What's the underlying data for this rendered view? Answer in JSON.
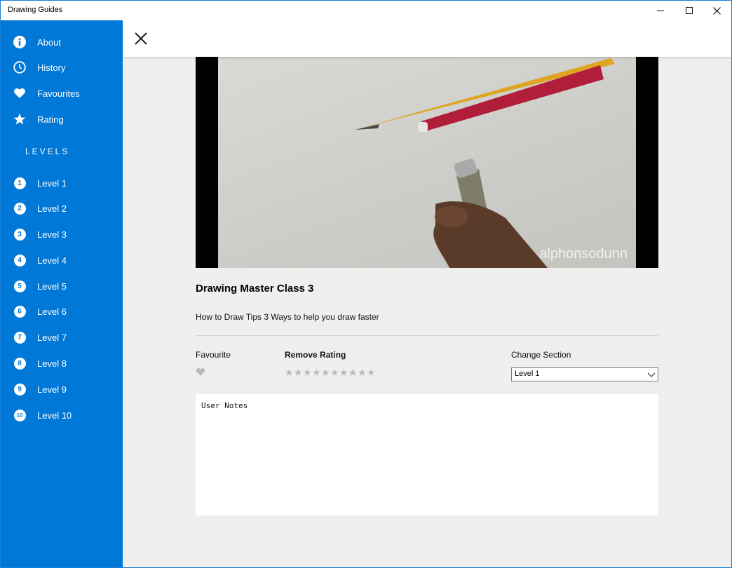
{
  "window": {
    "title": "Drawing Guides",
    "minimize": "—",
    "maximize": "☐",
    "close": "✕"
  },
  "sidebar": {
    "items": [
      {
        "label": "About",
        "icon": "info-icon"
      },
      {
        "label": "History",
        "icon": "clock-icon"
      },
      {
        "label": "Favourites",
        "icon": "heart-icon"
      },
      {
        "label": "Rating",
        "icon": "star-icon"
      }
    ],
    "levels_heading": "LEVELS",
    "levels": [
      {
        "num": "1",
        "label": "Level 1"
      },
      {
        "num": "2",
        "label": "Level 2"
      },
      {
        "num": "3",
        "label": "Level 3"
      },
      {
        "num": "4",
        "label": "Level 4"
      },
      {
        "num": "5",
        "label": "Level 5"
      },
      {
        "num": "6",
        "label": "Level 6"
      },
      {
        "num": "7",
        "label": "Level 7"
      },
      {
        "num": "8",
        "label": "Level 8"
      },
      {
        "num": "9",
        "label": "Level 9"
      },
      {
        "num": "10",
        "label": "Level 10"
      }
    ]
  },
  "video": {
    "watermark": "alphonsodunn"
  },
  "detail": {
    "title": "Drawing Master Class 3",
    "description": "How to Draw Tips 3 Ways to help you draw faster",
    "favourite_label": "Favourite",
    "rating_label": "Remove Rating",
    "rating_value": 0,
    "rating_max": 10,
    "section_label": "Change Section",
    "section_value": "Level 1",
    "notes_value": "User Notes"
  },
  "colors": {
    "accent": "#0078d7",
    "content_bg": "#efefef",
    "star_empty": "#b9b9b9"
  }
}
